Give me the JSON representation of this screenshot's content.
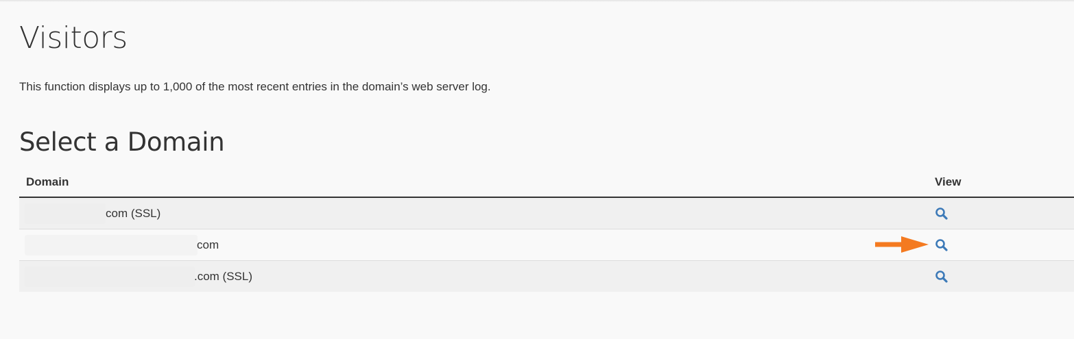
{
  "page": {
    "title": "Visitors",
    "description": "This function displays up to 1,000 of the most recent entries in the domain’s web server log.",
    "section_title": "Select a Domain"
  },
  "table": {
    "columns": {
      "domain": "Domain",
      "view": "View"
    },
    "rows": [
      {
        "domain": "com (SSL)",
        "view_icon": "search-icon"
      },
      {
        "domain": "com",
        "view_icon": "search-icon"
      },
      {
        "domain": ".com (SSL)",
        "view_icon": "search-icon"
      }
    ]
  },
  "annotation": {
    "arrow_color": "#f47a20"
  },
  "colors": {
    "icon": "#3d7ab8",
    "text": "#333333",
    "header_rule": "#333333",
    "stripe": "#f0f0f0"
  }
}
